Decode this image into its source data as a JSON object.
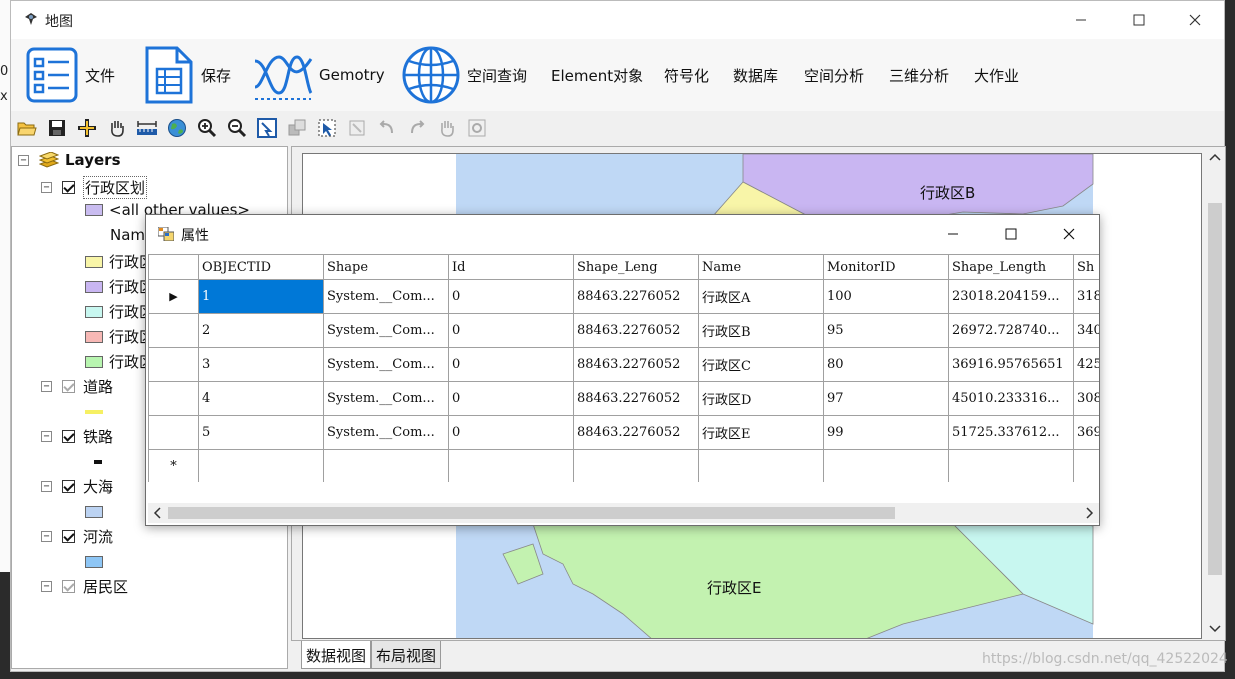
{
  "window": {
    "title": "地图"
  },
  "bg_left": {
    "line1": "0",
    "line2": "x"
  },
  "ribbon": [
    {
      "label": "文件",
      "icon": "list-document-icon"
    },
    {
      "label": "保存",
      "icon": "save-document-icon"
    },
    {
      "label": "Gemotry",
      "icon": "geometry-curve-icon"
    },
    {
      "label": "空间查询",
      "icon": "globe-icon"
    },
    {
      "label": "Element对象"
    },
    {
      "label": "符号化"
    },
    {
      "label": "数据库"
    },
    {
      "label": "空间分析"
    },
    {
      "label": "三维分析"
    },
    {
      "label": "大作业"
    }
  ],
  "toolbar_icons": [
    "open-folder-icon",
    "save-icon",
    "add-data-icon",
    "pan-hand-icon",
    "measure-icon",
    "full-extent-globe-icon",
    "zoom-in-icon",
    "zoom-out-icon",
    "identify-icon",
    "select-features-icon",
    "select-elements-icon",
    "clear-selection-icon",
    "undo-icon",
    "redo-icon",
    "pan-icon",
    "refresh-icon"
  ],
  "toc": {
    "root": "Layers",
    "layer1": {
      "name": "行政区划",
      "all_other": "<all other values>",
      "field": "Nam",
      "classes": [
        "行政区",
        "行政区",
        "行政区",
        "行政区",
        "行政区"
      ],
      "colors": [
        "#f8f5a8",
        "#c9b6f2",
        "#c8f7f0",
        "#f7b8b5",
        "#b8f5b0"
      ],
      "all_other_color": "#c9bcf0"
    },
    "layers": [
      {
        "name": "道路",
        "checked": true,
        "dim": true
      },
      {
        "name": "铁路",
        "checked": true,
        "dim": false
      },
      {
        "name": "大海",
        "checked": true,
        "dim": false
      },
      {
        "name": "河流",
        "checked": true,
        "dim": false
      },
      {
        "name": "居民区",
        "checked": true,
        "dim": true
      }
    ]
  },
  "map": {
    "label_b": "行政区B",
    "label_e": "行政区E",
    "colors": {
      "sea": "#bfd8f5",
      "b": "#c9b6f2",
      "a": "#f8f5a8",
      "e": "#c3f2b0",
      "c": "#c8f7f0",
      "d": "#f7b8b5"
    }
  },
  "tabs": {
    "data_view": "数据视图",
    "layout_view": "布局视图"
  },
  "watermark": "https://blog.csdn.net/qq_42522024",
  "dialog": {
    "title": "属性",
    "columns": [
      "OBJECTID",
      "Shape",
      "Id",
      "Shape_Leng",
      "Name",
      "MonitorID",
      "Shape_Length",
      "Sh"
    ],
    "rows": [
      [
        "1",
        "System.__Com...",
        "0",
        "88463.2276052",
        "行政区A",
        "100",
        "23018.204159...",
        "318"
      ],
      [
        "2",
        "System.__Com...",
        "0",
        "88463.2276052",
        "行政区B",
        "95",
        "26972.728740...",
        "340"
      ],
      [
        "3",
        "System.__Com...",
        "0",
        "88463.2276052",
        "行政区C",
        "80",
        "36916.95765651",
        "425"
      ],
      [
        "4",
        "System.__Com...",
        "0",
        "88463.2276052",
        "行政区D",
        "97",
        "45010.233316...",
        "308"
      ],
      [
        "5",
        "System.__Com...",
        "0",
        "88463.2276052",
        "行政区E",
        "99",
        "51725.337612...",
        "369"
      ]
    ],
    "current_row_marker": "▶",
    "new_row_marker": "*"
  }
}
